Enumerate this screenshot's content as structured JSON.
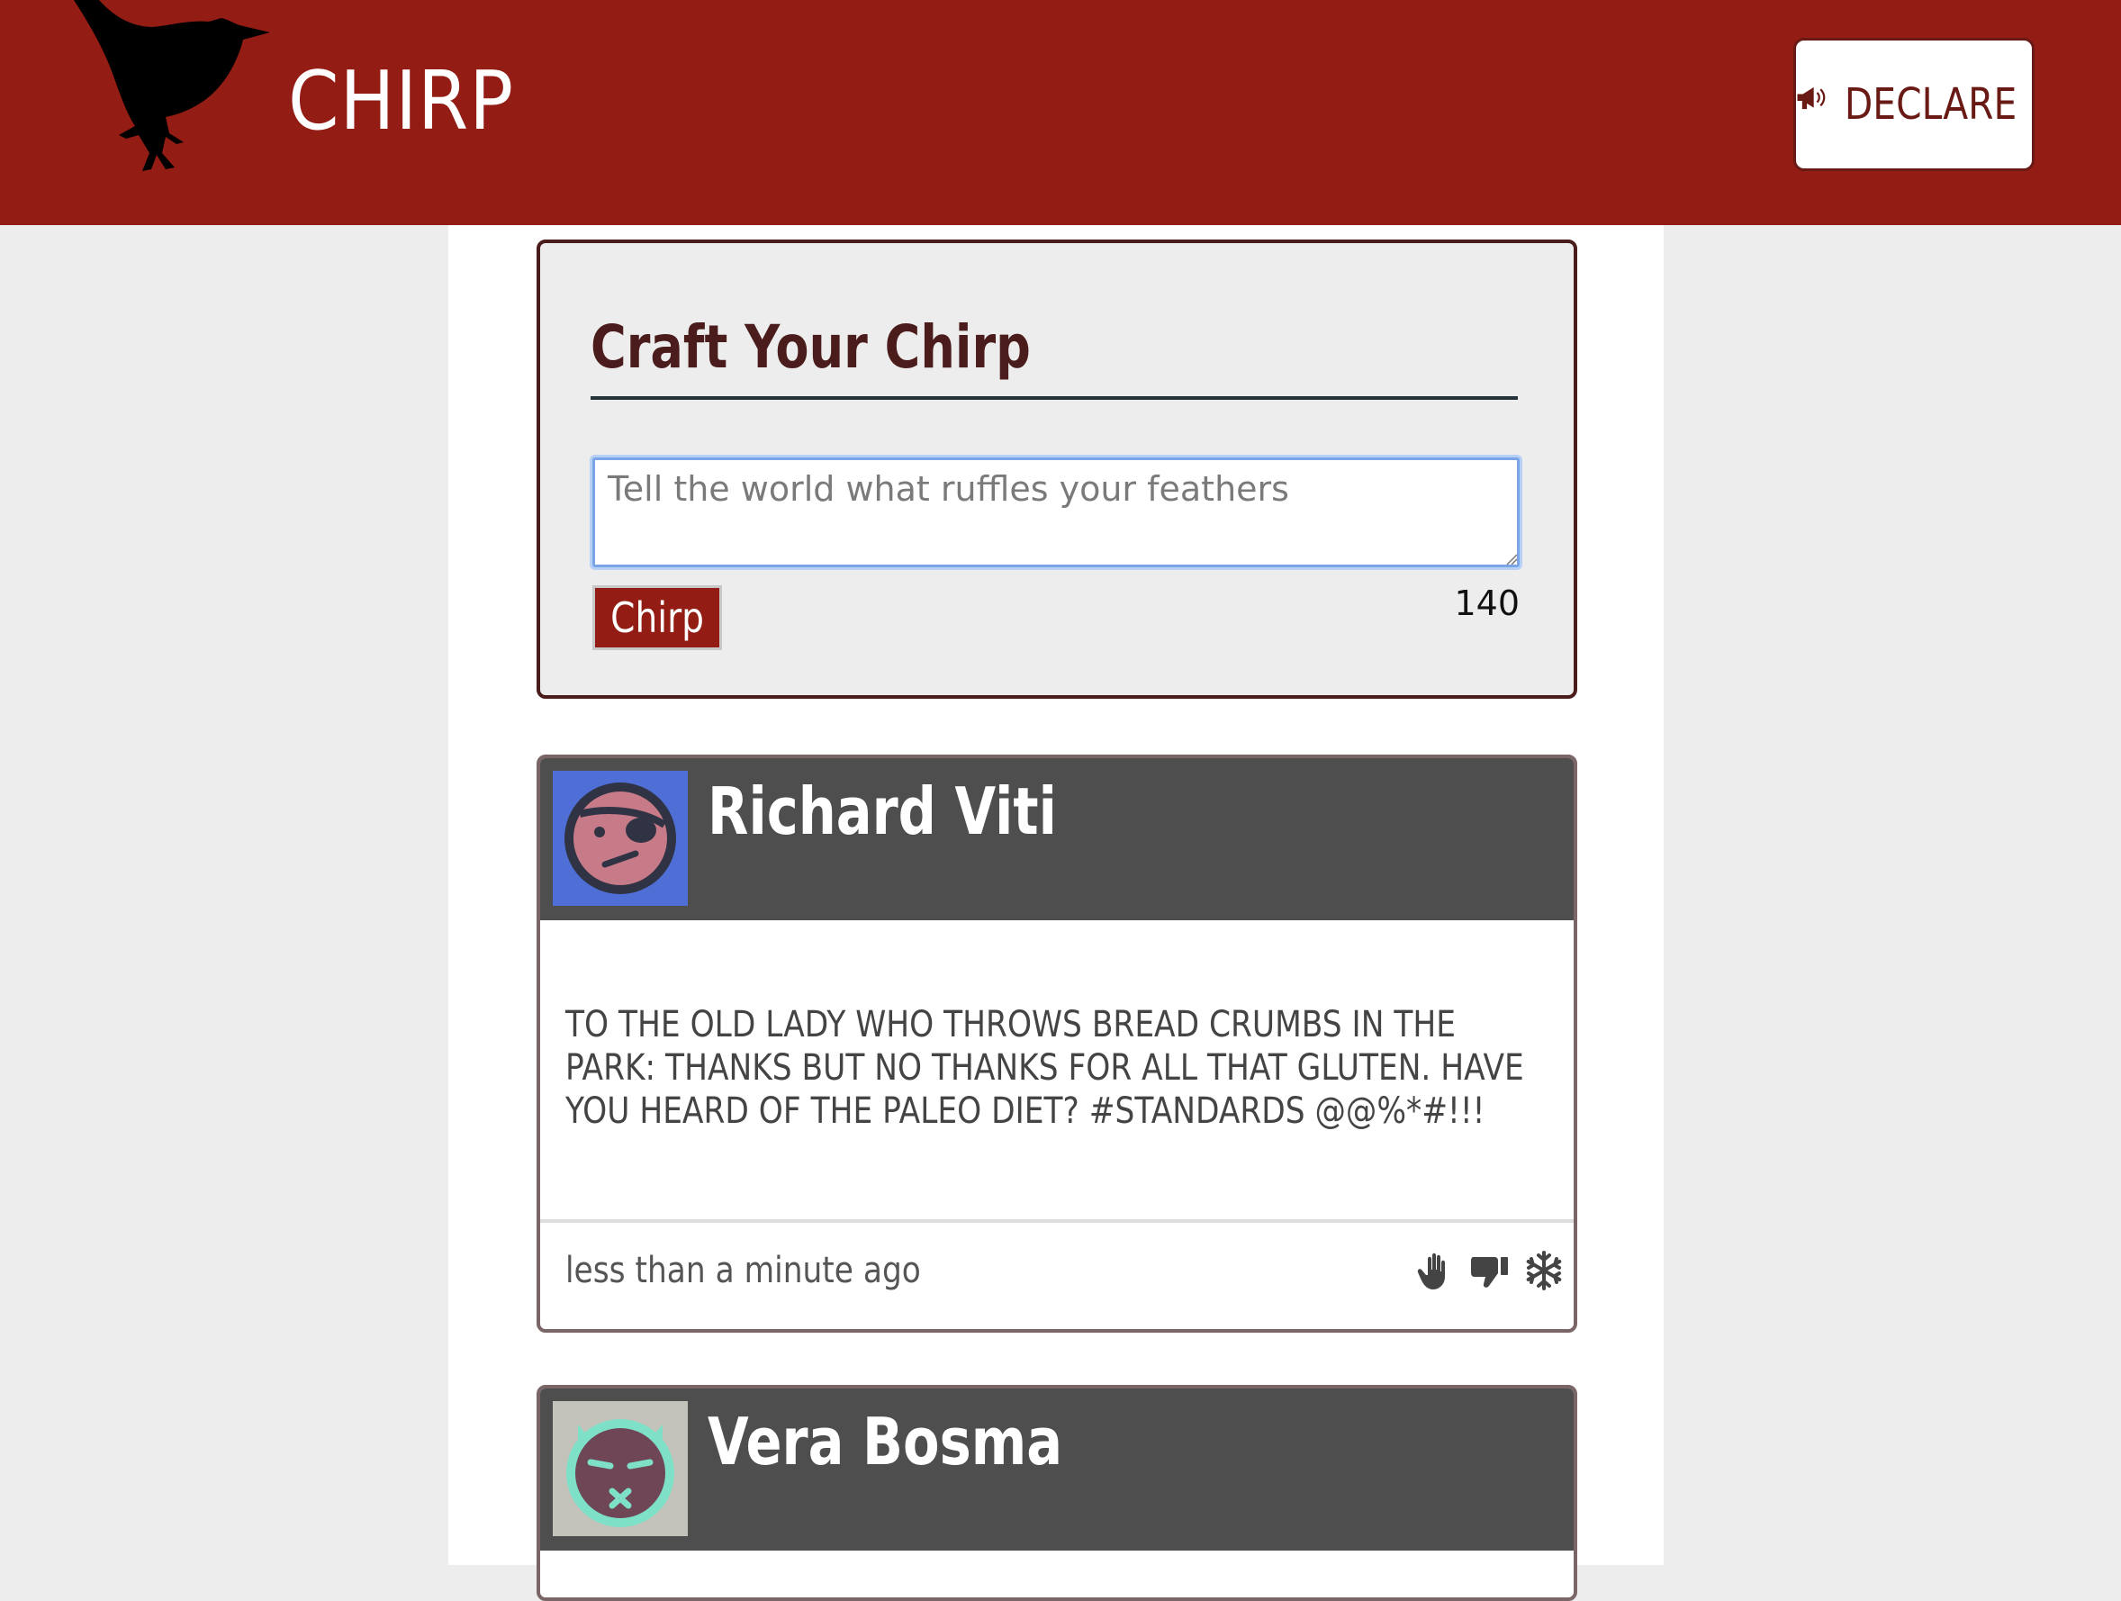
{
  "header": {
    "app_title": "CHIRP",
    "logo_icon": "bird-silhouette-icon",
    "declare_label": "DECLARE",
    "declare_icon": "megaphone-icon"
  },
  "compose": {
    "title": "Craft Your Chirp",
    "placeholder": "Tell the world what ruffles your feathers",
    "value": "",
    "submit_label": "Chirp",
    "char_count": "140"
  },
  "posts": [
    {
      "author": "Richard Viti",
      "avatar_icon": "eyepatch-face-avatar",
      "text": "TO THE OLD LADY WHO THROWS BREAD CRUMBS IN THE PARK: THANKS BUT NO THANKS FOR ALL THAT GLUTEN. HAVE YOU HEARD OF THE PALEO DIET? #STANDARDS @@%*#!!!",
      "timestamp": "less than a minute ago",
      "actions": [
        "hand-icon",
        "thumbs-down-icon",
        "snowflake-icon"
      ]
    },
    {
      "author": "Vera Bosma",
      "avatar_icon": "devil-face-avatar"
    }
  ],
  "colors": {
    "brand": "#931c14",
    "card_header": "#4e4e4e",
    "page_bg": "#ededed",
    "title_text": "#4a1c1c"
  }
}
